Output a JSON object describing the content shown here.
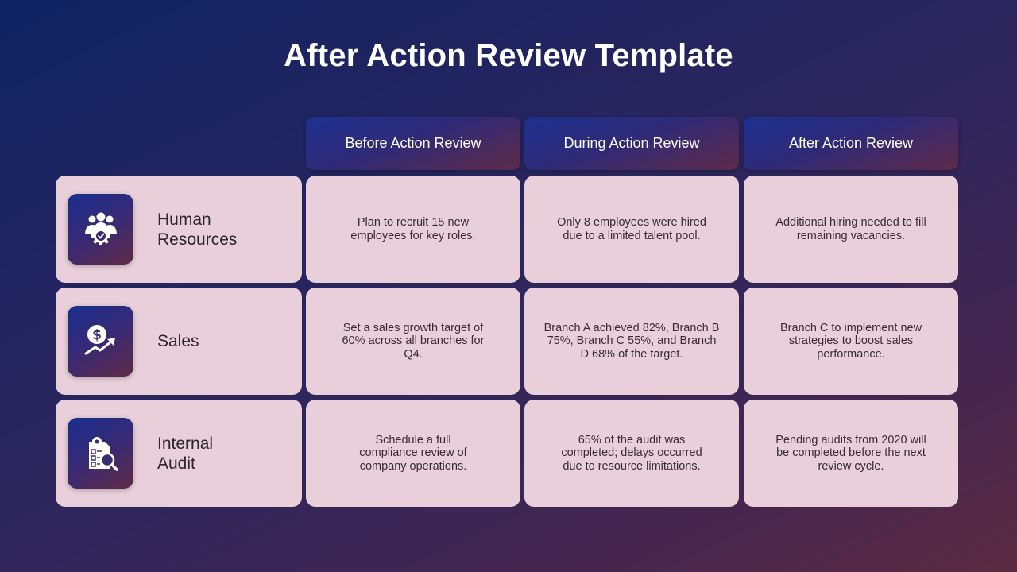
{
  "title": "After Action Review Template",
  "columns": [
    {
      "label": "Before Action Review"
    },
    {
      "label": "During Action Review"
    },
    {
      "label": "After Action Review"
    }
  ],
  "rows": [
    {
      "label_line1": "Human",
      "label_line2": "Resources",
      "icon": "team-gear-check-icon",
      "cells": [
        "Plan to recruit 15 new employees for key roles.",
        "Only 8 employees were hired due to a limited talent pool.",
        "Additional hiring needed to fill remaining vacancies."
      ]
    },
    {
      "label_line1": "Sales",
      "label_line2": "",
      "icon": "dollar-growth-icon",
      "cells": [
        "Set a sales growth target of 60% across all branches for Q4.",
        "Branch A achieved 82%, Branch B 75%, Branch C 55%, and Branch D 68% of the target.",
        "Branch C to implement new strategies to boost sales performance."
      ]
    },
    {
      "label_line1": "Internal",
      "label_line2": "Audit",
      "icon": "audit-checklist-search-icon",
      "cells": [
        "Schedule a full compliance review of company operations.",
        "65% of the audit was completed; delays occurred due to resource limitations.",
        "Pending audits from 2020 will be completed before the next review cycle."
      ]
    }
  ],
  "colors": {
    "background_start": "#0f2463",
    "background_end": "#5b2a40",
    "cell_fill": "#e8cfd9",
    "header_text": "#ffffff",
    "body_text": "#3a2b33"
  }
}
